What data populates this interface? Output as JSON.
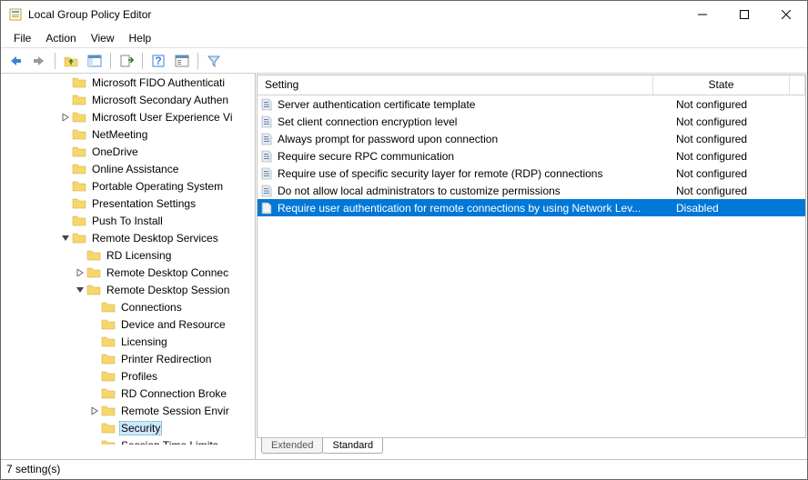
{
  "window": {
    "title": "Local Group Policy Editor"
  },
  "menubar": {
    "file": "File",
    "action": "Action",
    "view": "View",
    "help": "Help"
  },
  "tree": {
    "items": [
      {
        "indent": 4,
        "twisty": "",
        "label": "Microsoft FIDO Authenticati",
        "sel": false
      },
      {
        "indent": 4,
        "twisty": "",
        "label": "Microsoft Secondary Authen",
        "sel": false
      },
      {
        "indent": 4,
        "twisty": ">",
        "label": "Microsoft User Experience Vi",
        "sel": false
      },
      {
        "indent": 4,
        "twisty": "",
        "label": "NetMeeting",
        "sel": false
      },
      {
        "indent": 4,
        "twisty": "",
        "label": "OneDrive",
        "sel": false
      },
      {
        "indent": 4,
        "twisty": "",
        "label": "Online Assistance",
        "sel": false
      },
      {
        "indent": 4,
        "twisty": "",
        "label": "Portable Operating System",
        "sel": false
      },
      {
        "indent": 4,
        "twisty": "",
        "label": "Presentation Settings",
        "sel": false
      },
      {
        "indent": 4,
        "twisty": "",
        "label": "Push To Install",
        "sel": false
      },
      {
        "indent": 4,
        "twisty": "v",
        "label": "Remote Desktop Services",
        "sel": false
      },
      {
        "indent": 5,
        "twisty": "",
        "label": "RD Licensing",
        "sel": false
      },
      {
        "indent": 5,
        "twisty": ">",
        "label": "Remote Desktop Connec",
        "sel": false
      },
      {
        "indent": 5,
        "twisty": "v",
        "label": "Remote Desktop Session",
        "sel": false
      },
      {
        "indent": 6,
        "twisty": "",
        "label": "Connections",
        "sel": false
      },
      {
        "indent": 6,
        "twisty": "",
        "label": "Device and Resource",
        "sel": false
      },
      {
        "indent": 6,
        "twisty": "",
        "label": "Licensing",
        "sel": false
      },
      {
        "indent": 6,
        "twisty": "",
        "label": "Printer Redirection",
        "sel": false
      },
      {
        "indent": 6,
        "twisty": "",
        "label": "Profiles",
        "sel": false
      },
      {
        "indent": 6,
        "twisty": "",
        "label": "RD Connection Broke",
        "sel": false
      },
      {
        "indent": 6,
        "twisty": ">",
        "label": "Remote Session Envir",
        "sel": false
      },
      {
        "indent": 6,
        "twisty": "",
        "label": "Security",
        "sel": true
      },
      {
        "indent": 6,
        "twisty": "",
        "label": "Session Time Limits",
        "sel": false
      }
    ],
    "scrollUpGlyph": "^"
  },
  "list": {
    "columns": {
      "setting": "Setting",
      "state": "State"
    },
    "rows": [
      {
        "name": "Server authentication certificate template",
        "state": "Not configured",
        "sel": false
      },
      {
        "name": "Set client connection encryption level",
        "state": "Not configured",
        "sel": false
      },
      {
        "name": "Always prompt for password upon connection",
        "state": "Not configured",
        "sel": false
      },
      {
        "name": "Require secure RPC communication",
        "state": "Not configured",
        "sel": false
      },
      {
        "name": "Require use of specific security layer for remote (RDP) connections",
        "state": "Not configured",
        "sel": false
      },
      {
        "name": "Do not allow local administrators to customize permissions",
        "state": "Not configured",
        "sel": false
      },
      {
        "name": "Require user authentication for remote connections by using Network Lev...",
        "state": "Disabled",
        "sel": true
      }
    ]
  },
  "tabs": {
    "extended": "Extended",
    "standard": "Standard"
  },
  "status": {
    "text": "7 setting(s)"
  }
}
